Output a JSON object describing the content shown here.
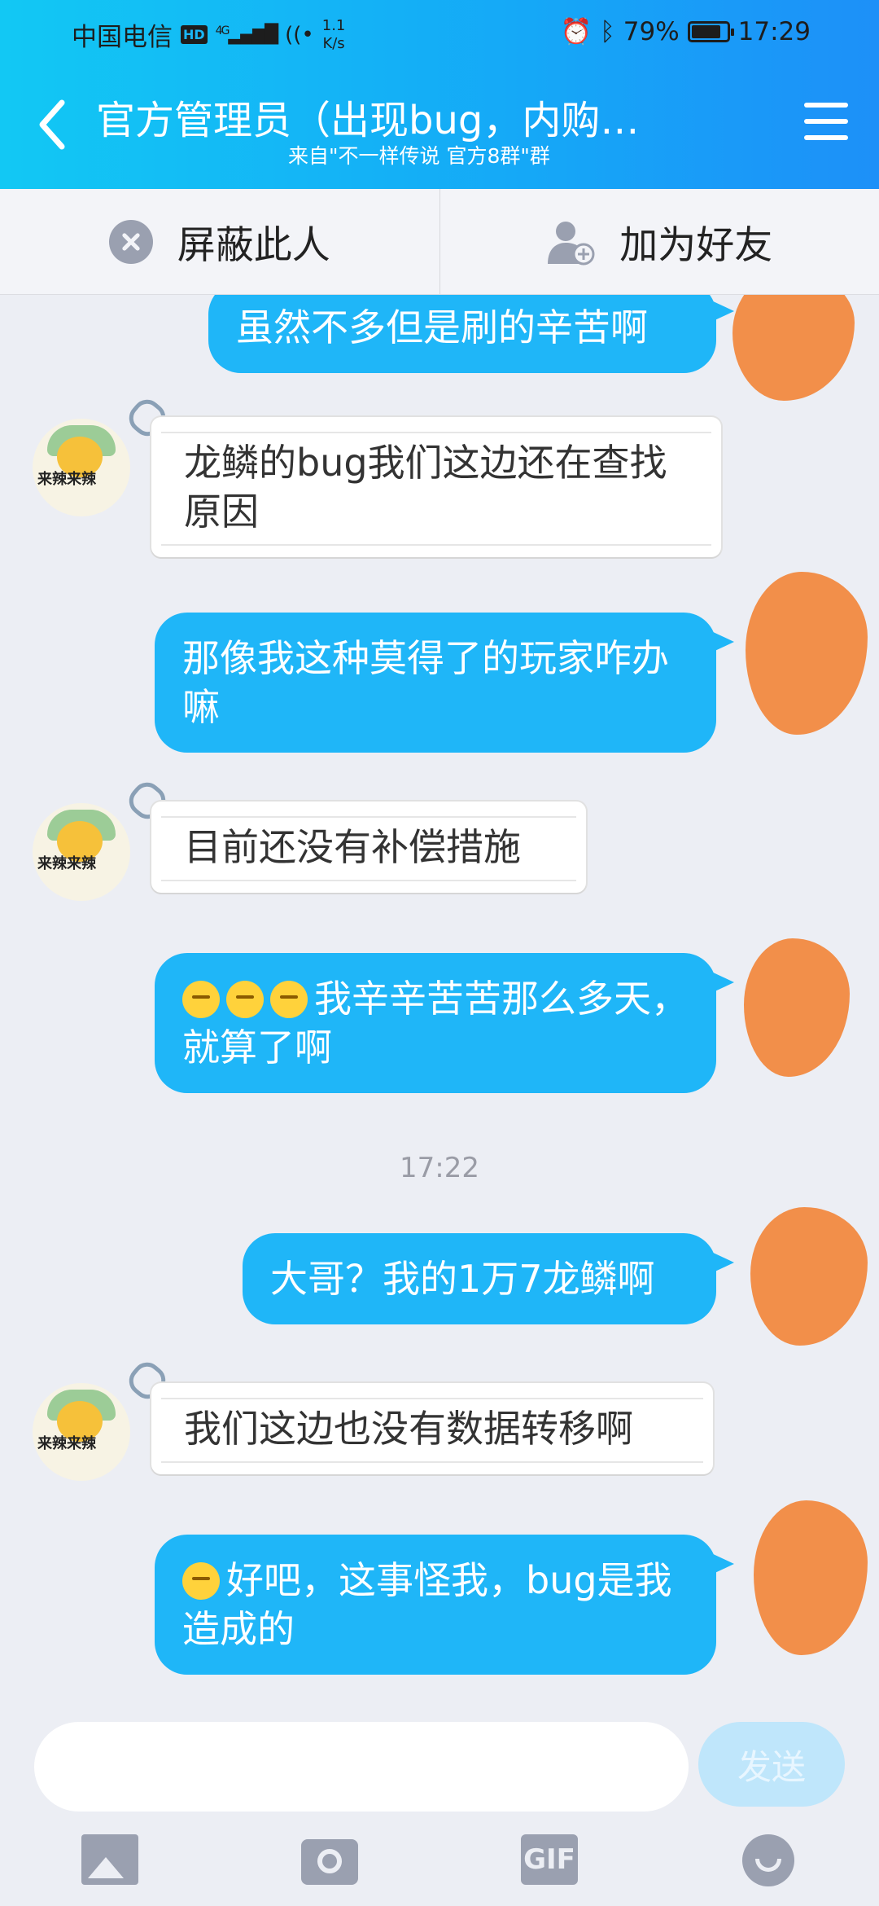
{
  "status_bar": {
    "carrier": "中国电信",
    "hd_badge": "HD",
    "signal": "4G",
    "speed_value": "1.1",
    "speed_unit": "K/s",
    "battery": "79%",
    "battery_level": 0.79,
    "time": "17:29"
  },
  "header": {
    "title": "官方管理员（出现bug，内购…",
    "subtitle": "来自\"不一样传说 官方8群\"群"
  },
  "actions": {
    "block_label": "屏蔽此人",
    "add_friend_label": "加为好友"
  },
  "messages": [
    {
      "dir": "out",
      "text": "虽然不多但是刷的辛苦啊"
    },
    {
      "dir": "in",
      "text": "龙鳞的bug我们这边还在查找原因"
    },
    {
      "dir": "out",
      "text": "那像我这种莫得了的玩家咋办嘛"
    },
    {
      "dir": "in",
      "text": "目前还没有补偿措施"
    },
    {
      "dir": "out",
      "text": "我辛辛苦苦那么多天，就算了啊"
    },
    {
      "dir": "time",
      "text": "17:22"
    },
    {
      "dir": "out",
      "text": "大哥？我的1万7龙鳞啊"
    },
    {
      "dir": "in",
      "text": "我们这边也没有数据转移啊"
    },
    {
      "dir": "out",
      "text": "好吧，这事怪我，bug是我造成的"
    }
  ],
  "avatar_caption": "来辣来辣",
  "input": {
    "placeholder": "",
    "send_label": "发送"
  },
  "toolbar": {
    "gif_label": "GIF"
  },
  "colors": {
    "header_start": "#12c8f4",
    "header_end": "#1d90f8",
    "outgoing_bubble": "#1fb6f8",
    "incoming_bubble": "#ffffff",
    "redaction": "#f28f4a",
    "background": "#eceef4"
  }
}
